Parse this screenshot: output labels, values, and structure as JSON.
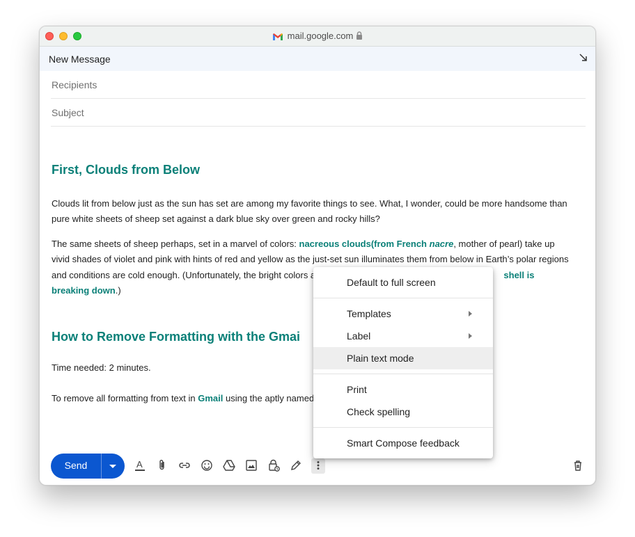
{
  "browser": {
    "url": "mail.google.com"
  },
  "compose": {
    "title": "New Message",
    "recipients_placeholder": "Recipients",
    "subject_placeholder": "Subject"
  },
  "content": {
    "heading1": "First, Clouds from Below",
    "p1": "Clouds lit from below just as the sun has set are among my favorite things to see. What, I wonder, could be more handsome than pure white sheets of sheep set against a dark blue sky over green and rocky hills?",
    "p2_a": "The same sheets of sheep perhaps, set in a marvel of colors: ",
    "p2_link1": "nacreous clouds",
    "p2_link2": "(from French ",
    "p2_link2_italic": "nacre",
    "p2_b": ", mother of pearl) take up vivid shades of violet and pink with hints of red and yellow as the just-set sun illuminates them from below in Earth’s polar regions and conditions are cold enough. (Unfortunately, the bright colors also",
    "p2_link3": "shell is breaking down",
    "p2_c": ".)",
    "heading2": "How to Remove Formatting with the Gmai",
    "p3": "Time needed: 2 minutes.",
    "p4_a": "To remove all formatting from text in ",
    "p4_link": "Gmail",
    "p4_b": " using the aptly named"
  },
  "toolbar": {
    "send_label": "Send",
    "icons": [
      "formatting-icon",
      "attach-icon",
      "link-icon",
      "emoji-icon",
      "drive-icon",
      "photo-icon",
      "confidential-icon",
      "signature-icon",
      "more-options-icon",
      "trash-icon"
    ]
  },
  "menu": {
    "items": [
      {
        "label": "Default to full screen"
      },
      {
        "label": "Templates",
        "submenu": true
      },
      {
        "label": "Label",
        "submenu": true
      },
      {
        "label": "Plain text mode",
        "highlighted": true
      },
      {
        "label": "Print"
      },
      {
        "label": "Check spelling"
      },
      {
        "label": "Smart Compose feedback"
      }
    ]
  },
  "colors": {
    "accent": "#0b57d0",
    "heading": "#0b8078",
    "header_bg": "#f2f6fc"
  }
}
